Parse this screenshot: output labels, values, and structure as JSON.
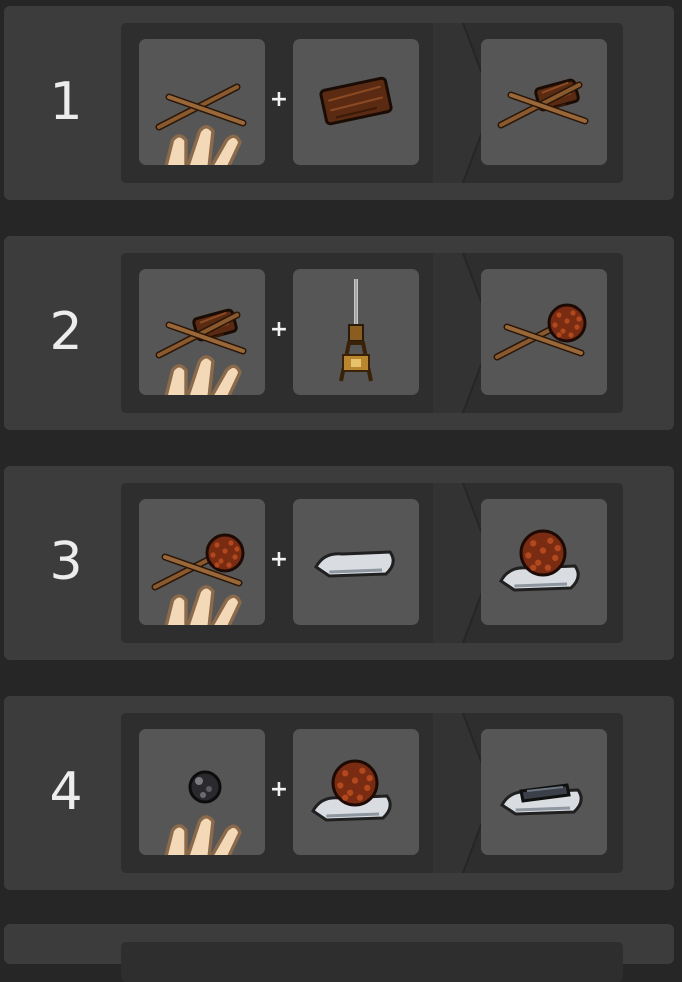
{
  "steps": [
    {
      "number": "1",
      "plus": "+",
      "inputs": [
        "sticks-icon",
        "wood-plank-icon"
      ],
      "output": "fire-drill-sticks-icon",
      "hand_on_first": true
    },
    {
      "number": "2",
      "plus": "+",
      "inputs": [
        "fire-drill-sticks-icon",
        "bow-drill-icon"
      ],
      "output": "smoldering-tinder-icon",
      "hand_on_first": true
    },
    {
      "number": "3",
      "plus": "+",
      "inputs": [
        "smoldering-tinder-icon",
        "flat-stone-icon"
      ],
      "output": "ember-on-stone-icon",
      "hand_on_first": true
    },
    {
      "number": "4",
      "plus": "+",
      "inputs": [
        "charcoal-lump-icon",
        "ember-on-stone-icon"
      ],
      "output": "charcoal-on-stone-icon",
      "hand_on_first": true
    }
  ],
  "colors": {
    "background": "#262626",
    "card": "#3c3c3c",
    "recipe_panel": "#2e2e2e",
    "slot": "#565656",
    "text": "#ededed"
  }
}
